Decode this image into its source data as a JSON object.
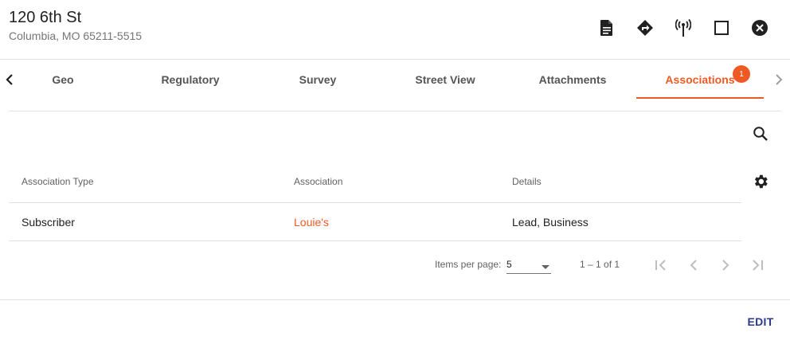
{
  "header": {
    "title": "120 6th St",
    "subtitle": "Columbia, MO 65211-5515",
    "icons": [
      "document-icon",
      "directions-icon",
      "antenna-icon",
      "maximize-icon",
      "close-icon"
    ]
  },
  "tabs": {
    "items": [
      {
        "label": "Geo"
      },
      {
        "label": "Regulatory"
      },
      {
        "label": "Survey"
      },
      {
        "label": "Street View"
      },
      {
        "label": "Attachments"
      },
      {
        "label": "Associations",
        "badge": "1"
      }
    ],
    "active": "Associations"
  },
  "table": {
    "columns": [
      "Association Type",
      "Association",
      "Details"
    ],
    "rows": [
      {
        "type": "Subscriber",
        "association": "Louie's",
        "details": "Lead, Business"
      }
    ]
  },
  "paginator": {
    "items_per_page_label": "Items per page:",
    "items_per_page_value": "5",
    "range_label": "1 – 1 of 1"
  },
  "footer": {
    "edit_label": "EDIT"
  },
  "colors": {
    "accent": "#ef5a24",
    "edit": "#2b3a8c",
    "divider": "#e0e0e0"
  }
}
